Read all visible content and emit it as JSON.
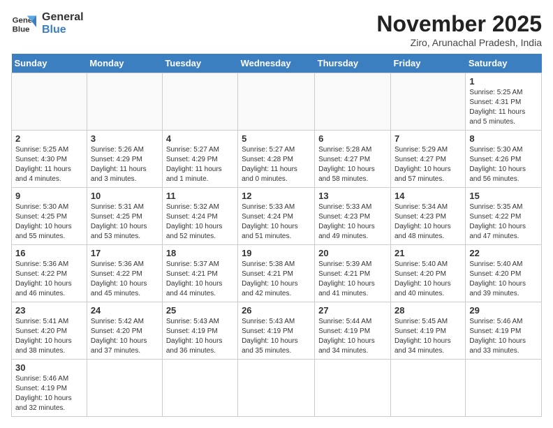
{
  "logo": {
    "line1": "General",
    "line2": "Blue"
  },
  "title": "November 2025",
  "location": "Ziro, Arunachal Pradesh, India",
  "days_of_week": [
    "Sunday",
    "Monday",
    "Tuesday",
    "Wednesday",
    "Thursday",
    "Friday",
    "Saturday"
  ],
  "weeks": [
    [
      {
        "day": "",
        "info": ""
      },
      {
        "day": "",
        "info": ""
      },
      {
        "day": "",
        "info": ""
      },
      {
        "day": "",
        "info": ""
      },
      {
        "day": "",
        "info": ""
      },
      {
        "day": "",
        "info": ""
      },
      {
        "day": "1",
        "info": "Sunrise: 5:25 AM\nSunset: 4:31 PM\nDaylight: 11 hours and 5 minutes."
      }
    ],
    [
      {
        "day": "2",
        "info": "Sunrise: 5:25 AM\nSunset: 4:30 PM\nDaylight: 11 hours and 4 minutes."
      },
      {
        "day": "3",
        "info": "Sunrise: 5:26 AM\nSunset: 4:29 PM\nDaylight: 11 hours and 3 minutes."
      },
      {
        "day": "4",
        "info": "Sunrise: 5:27 AM\nSunset: 4:29 PM\nDaylight: 11 hours and 1 minute."
      },
      {
        "day": "5",
        "info": "Sunrise: 5:27 AM\nSunset: 4:28 PM\nDaylight: 11 hours and 0 minutes."
      },
      {
        "day": "6",
        "info": "Sunrise: 5:28 AM\nSunset: 4:27 PM\nDaylight: 10 hours and 58 minutes."
      },
      {
        "day": "7",
        "info": "Sunrise: 5:29 AM\nSunset: 4:27 PM\nDaylight: 10 hours and 57 minutes."
      },
      {
        "day": "8",
        "info": "Sunrise: 5:30 AM\nSunset: 4:26 PM\nDaylight: 10 hours and 56 minutes."
      }
    ],
    [
      {
        "day": "9",
        "info": "Sunrise: 5:30 AM\nSunset: 4:25 PM\nDaylight: 10 hours and 55 minutes."
      },
      {
        "day": "10",
        "info": "Sunrise: 5:31 AM\nSunset: 4:25 PM\nDaylight: 10 hours and 53 minutes."
      },
      {
        "day": "11",
        "info": "Sunrise: 5:32 AM\nSunset: 4:24 PM\nDaylight: 10 hours and 52 minutes."
      },
      {
        "day": "12",
        "info": "Sunrise: 5:33 AM\nSunset: 4:24 PM\nDaylight: 10 hours and 51 minutes."
      },
      {
        "day": "13",
        "info": "Sunrise: 5:33 AM\nSunset: 4:23 PM\nDaylight: 10 hours and 49 minutes."
      },
      {
        "day": "14",
        "info": "Sunrise: 5:34 AM\nSunset: 4:23 PM\nDaylight: 10 hours and 48 minutes."
      },
      {
        "day": "15",
        "info": "Sunrise: 5:35 AM\nSunset: 4:22 PM\nDaylight: 10 hours and 47 minutes."
      }
    ],
    [
      {
        "day": "16",
        "info": "Sunrise: 5:36 AM\nSunset: 4:22 PM\nDaylight: 10 hours and 46 minutes."
      },
      {
        "day": "17",
        "info": "Sunrise: 5:36 AM\nSunset: 4:22 PM\nDaylight: 10 hours and 45 minutes."
      },
      {
        "day": "18",
        "info": "Sunrise: 5:37 AM\nSunset: 4:21 PM\nDaylight: 10 hours and 44 minutes."
      },
      {
        "day": "19",
        "info": "Sunrise: 5:38 AM\nSunset: 4:21 PM\nDaylight: 10 hours and 42 minutes."
      },
      {
        "day": "20",
        "info": "Sunrise: 5:39 AM\nSunset: 4:21 PM\nDaylight: 10 hours and 41 minutes."
      },
      {
        "day": "21",
        "info": "Sunrise: 5:40 AM\nSunset: 4:20 PM\nDaylight: 10 hours and 40 minutes."
      },
      {
        "day": "22",
        "info": "Sunrise: 5:40 AM\nSunset: 4:20 PM\nDaylight: 10 hours and 39 minutes."
      }
    ],
    [
      {
        "day": "23",
        "info": "Sunrise: 5:41 AM\nSunset: 4:20 PM\nDaylight: 10 hours and 38 minutes."
      },
      {
        "day": "24",
        "info": "Sunrise: 5:42 AM\nSunset: 4:20 PM\nDaylight: 10 hours and 37 minutes."
      },
      {
        "day": "25",
        "info": "Sunrise: 5:43 AM\nSunset: 4:19 PM\nDaylight: 10 hours and 36 minutes."
      },
      {
        "day": "26",
        "info": "Sunrise: 5:43 AM\nSunset: 4:19 PM\nDaylight: 10 hours and 35 minutes."
      },
      {
        "day": "27",
        "info": "Sunrise: 5:44 AM\nSunset: 4:19 PM\nDaylight: 10 hours and 34 minutes."
      },
      {
        "day": "28",
        "info": "Sunrise: 5:45 AM\nSunset: 4:19 PM\nDaylight: 10 hours and 34 minutes."
      },
      {
        "day": "29",
        "info": "Sunrise: 5:46 AM\nSunset: 4:19 PM\nDaylight: 10 hours and 33 minutes."
      }
    ],
    [
      {
        "day": "30",
        "info": "Sunrise: 5:46 AM\nSunset: 4:19 PM\nDaylight: 10 hours and 32 minutes."
      },
      {
        "day": "",
        "info": ""
      },
      {
        "day": "",
        "info": ""
      },
      {
        "day": "",
        "info": ""
      },
      {
        "day": "",
        "info": ""
      },
      {
        "day": "",
        "info": ""
      },
      {
        "day": "",
        "info": ""
      }
    ]
  ]
}
